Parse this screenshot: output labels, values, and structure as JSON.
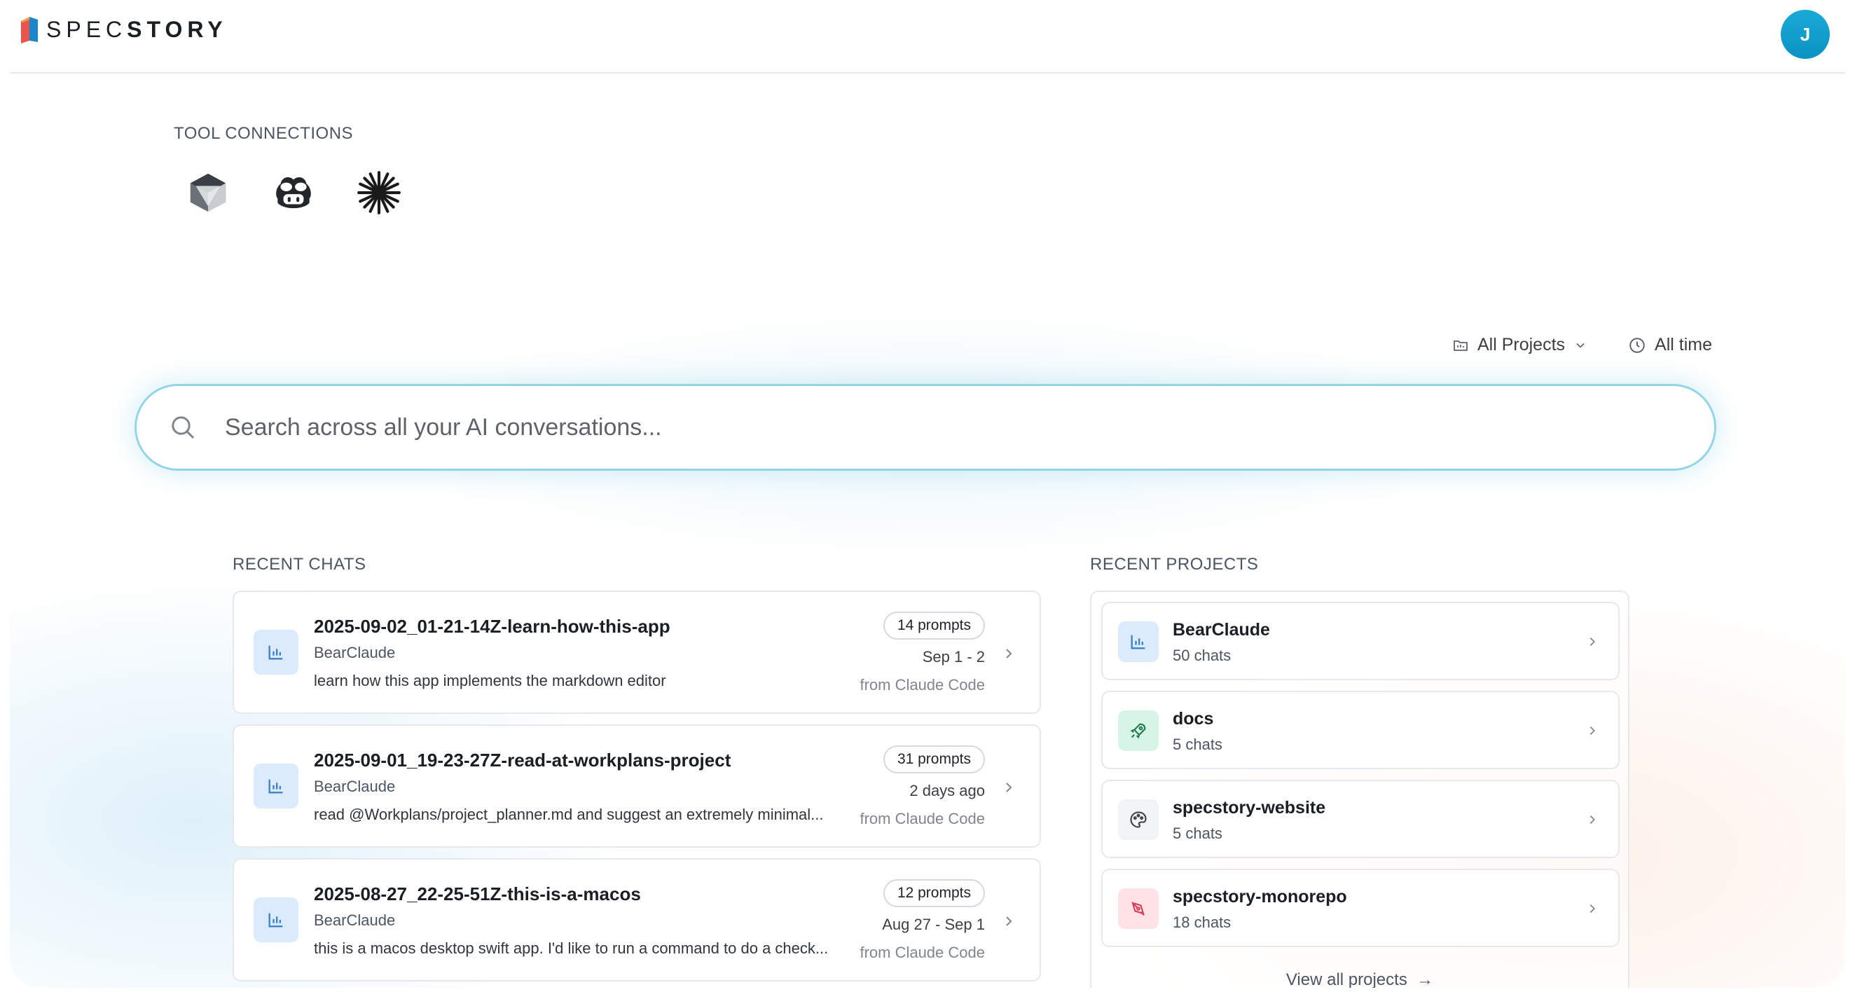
{
  "header": {
    "logo_light": "SPEC",
    "logo_bold": "STORY",
    "avatar_initial": "J"
  },
  "tools": {
    "section_label": "TOOL CONNECTIONS",
    "icons": [
      "cursor-icon",
      "copilot-icon",
      "claude-icon"
    ]
  },
  "filters": {
    "projects_label": "All Projects",
    "time_label": "All time"
  },
  "search": {
    "placeholder": "Search across all your AI conversations..."
  },
  "recent_chats": {
    "section_label": "RECENT CHATS",
    "items": [
      {
        "title": "2025-09-02_01-21-14Z-learn-how-this-app",
        "project": "BearClaude",
        "preview": "learn how this app implements the markdown editor",
        "prompts": "14 prompts",
        "date": "Sep 1 - 2",
        "source": "from Claude Code"
      },
      {
        "title": "2025-09-01_19-23-27Z-read-at-workplans-project",
        "project": "BearClaude",
        "preview": "read @Workplans/project_planner.md and suggest an extremely minimal...",
        "prompts": "31 prompts",
        "date": "2 days ago",
        "source": "from Claude Code"
      },
      {
        "title": "2025-08-27_22-25-51Z-this-is-a-macos",
        "project": "BearClaude",
        "preview": "this is a macos desktop swift app. I'd like to run a command to do a check...",
        "prompts": "12 prompts",
        "date": "Aug 27 - Sep 1",
        "source": "from Claude Code"
      }
    ]
  },
  "recent_projects": {
    "section_label": "RECENT PROJECTS",
    "items": [
      {
        "name": "BearClaude",
        "count": "50 chats",
        "icon": "chart-icon",
        "color": "#dcebfb"
      },
      {
        "name": "docs",
        "count": "5 chats",
        "icon": "rocket-icon",
        "color": "#d6f5e6"
      },
      {
        "name": "specstory-website",
        "count": "5 chats",
        "icon": "palette-icon",
        "color": "#f1f3f5"
      },
      {
        "name": "specstory-monorepo",
        "count": "18 chats",
        "icon": "pen-icon",
        "color": "#fde2e6"
      }
    ],
    "view_all": "View all projects"
  }
}
